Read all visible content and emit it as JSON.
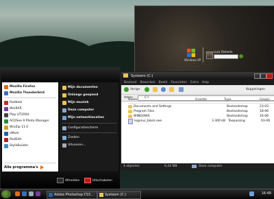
{
  "login": {
    "brand": "Windows XP",
    "username": "Luca Distante"
  },
  "start_menu": {
    "pinned": [
      "Mozilla Firefox",
      "Mozilla Thunderbird"
    ],
    "recent": [
      "Radblok",
      "WinRAR",
      "Play UT2004",
      "ACDSee 9 Photo Manager",
      "WinZip 11.0",
      "eMule",
      "RedEdit",
      "StyleBuilder"
    ],
    "all_programs": "Alle programma's",
    "right_items": [
      "Mijn documenten",
      "Onlangs geopend",
      "Mijn muziek",
      "Deze computer",
      "Mijn netwerklocaties",
      "Configuratiescherm",
      "Zoeken",
      "Uitvoeren..."
    ],
    "logoff": "Afmelden",
    "shutdown": "Uitschakelen"
  },
  "explorer": {
    "title": "Systeem (C:)",
    "menu": [
      "Bestand",
      "Bewerken",
      "Beeld",
      "Favorieten",
      "Extra",
      "Help"
    ],
    "toolbar": {
      "back": "Vorige",
      "links": "Koppelingen"
    },
    "address_label": "Adres",
    "address_value": "C:\\",
    "columns": [
      "Naam",
      "Grootte",
      "Type",
      "Gewijz"
    ],
    "rows": [
      {
        "name": "Documents and Settings",
        "size": "",
        "type": "Bestandsmap",
        "date": "23-03"
      },
      {
        "name": "Program Files",
        "size": "",
        "type": "Bestandsmap",
        "date": "18-06"
      },
      {
        "name": "WINDOWS",
        "size": "",
        "type": "Bestandsmap",
        "date": "16-06"
      },
      {
        "name": "logonui_black.exe",
        "size": "3.300 kB",
        "type": "Toepassing",
        "date": "03-06"
      }
    ],
    "status": {
      "objects": "4 objecten",
      "size": "6,44 MB",
      "location": "Deze computer"
    }
  },
  "taskbar": {
    "tasks": [
      "Adobe Photoshop CS3...",
      "Systeem (C:)"
    ],
    "clock": "16:48"
  }
}
